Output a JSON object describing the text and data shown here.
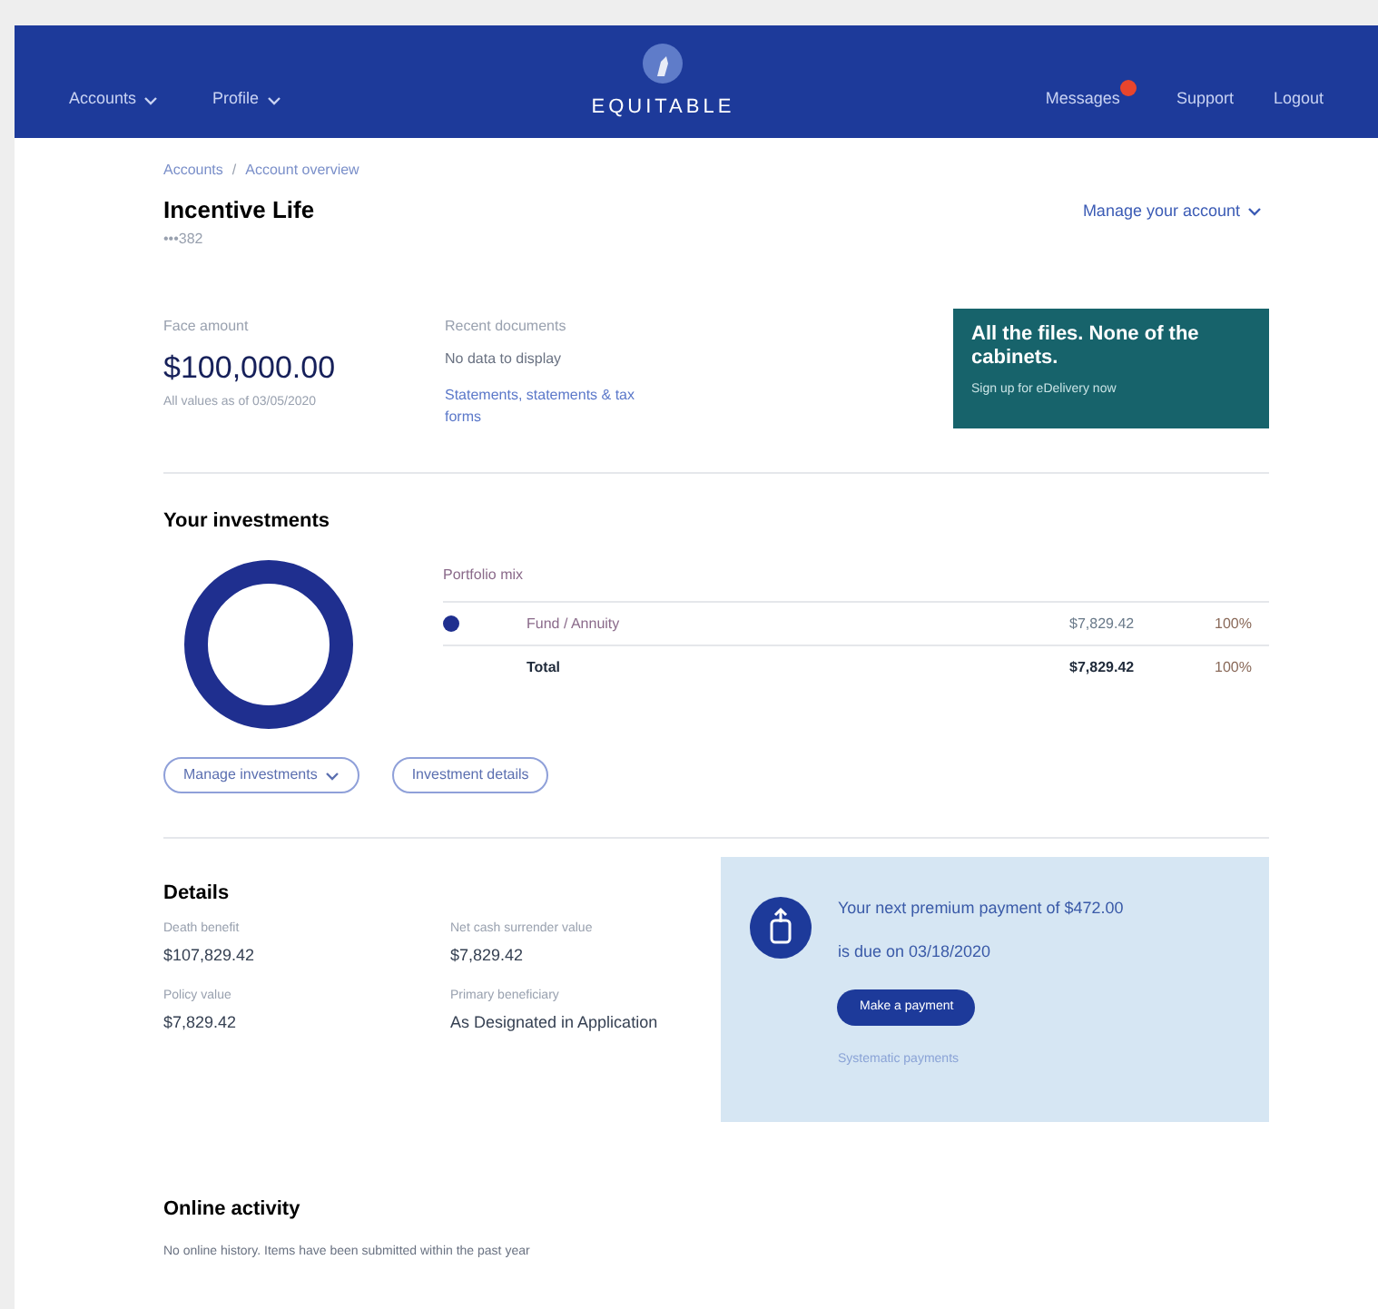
{
  "nav": {
    "left": [
      {
        "label": "Accounts"
      },
      {
        "label": "Profile"
      }
    ],
    "brand": "EQUITABLE",
    "right": [
      {
        "label": "Messages",
        "badge": true
      },
      {
        "label": "Support",
        "badge": false
      },
      {
        "label": "Logout",
        "badge": false
      }
    ]
  },
  "breadcrumb": {
    "separator": "/",
    "items": [
      "Accounts",
      "Account overview"
    ]
  },
  "policy": {
    "title": "Incentive Life",
    "number": "•••382",
    "manage": "Manage your account"
  },
  "summary": {
    "face_label": "Face amount",
    "face_value": "$100,000.00",
    "face_note": "All values as of 03/05/2020",
    "docs_label": "Recent documents",
    "docs_empty": "No data to display",
    "docs_link": "Statements, statements & tax forms"
  },
  "promo": {
    "title": "All the files. None of the cabinets.",
    "link": "Sign up for eDelivery now"
  },
  "investments": {
    "title": "Your investments",
    "mix_label": "Portfolio mix",
    "rows": [
      {
        "kind": "fund",
        "color": "#1f2f8f",
        "name": "Fund / Annuity",
        "amount": "$7,829.42",
        "percent": "100%"
      },
      {
        "kind": "total",
        "name": "Total",
        "amount": "$7,829.42",
        "percent": "100%"
      }
    ],
    "buttons": [
      {
        "label": "Manage investments",
        "dropdown": true
      },
      {
        "label": "Investment details",
        "dropdown": false
      }
    ]
  },
  "details": {
    "title": "Details",
    "items": [
      {
        "label": "Death benefit",
        "value": "$107,829.42"
      },
      {
        "label": "Net cash surrender value",
        "value": "$7,829.42"
      },
      {
        "label": "Policy value",
        "value": "$7,829.42"
      },
      {
        "label": "Primary beneficiary",
        "value": "As Designated in Application"
      }
    ]
  },
  "payment": {
    "line1": "Your next premium payment of $472.00",
    "line2": "is due on 03/18/2020",
    "button": "Make a payment",
    "link": "Systematic payments"
  },
  "activity": {
    "title": "Online activity",
    "text": "No online history. Items have been submitted within the past year"
  }
}
